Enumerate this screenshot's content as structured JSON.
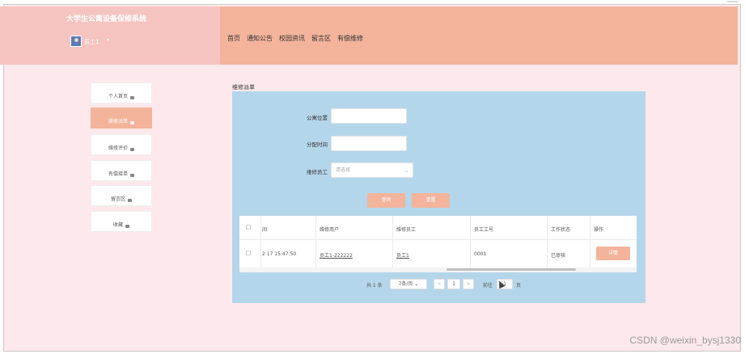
{
  "header": {
    "site_title": "大学生公寓设备保修系统",
    "user_name": "员工1",
    "user_caret": "▾",
    "nav": [
      "首页",
      "通知公告",
      "校园资讯",
      "留言区",
      "有偿维修"
    ]
  },
  "sidebar": {
    "items": [
      {
        "label": "个人首页",
        "active": false
      },
      {
        "label": "维修派单",
        "active": true
      },
      {
        "label": "维修评价",
        "active": false
      },
      {
        "label": "有偿接单",
        "active": false
      },
      {
        "label": "留言区",
        "active": false
      },
      {
        "label": "收藏",
        "active": false
      }
    ]
  },
  "main": {
    "breadcrumb": "维修派单",
    "form": {
      "location_label": "公寓位置",
      "location_value": "",
      "time_label": "分配时间",
      "time_value": "",
      "staff_label": "维修员工",
      "staff_placeholder": "请选择",
      "search_button": "查询",
      "reset_button": "重置"
    },
    "table": {
      "headers": [
        "间",
        "维修用户",
        "维修员工",
        "员工工号",
        "工作状态",
        "操作"
      ],
      "rows": [
        {
          "time": "2 17 15:47:50",
          "user": "员工1-222222",
          "staff": "员工1",
          "staff_no": "0001",
          "status": "已审核",
          "action": "详情"
        }
      ]
    },
    "pagination": {
      "total": "共 1 条",
      "page_size": "7条/页",
      "prev": "<",
      "current_page": "1",
      "next": ">",
      "goto_label": "前往",
      "goto_value": "1",
      "page_suffix": "页"
    }
  },
  "watermark": "CSDN @weixin_bysj1330",
  "colors": {
    "header_left": "#f6c4c0",
    "header_right": "#f3b49b",
    "page_bg": "#fde9ec",
    "panel_bg": "#b4d6ea",
    "accent": "#f3b49b"
  }
}
